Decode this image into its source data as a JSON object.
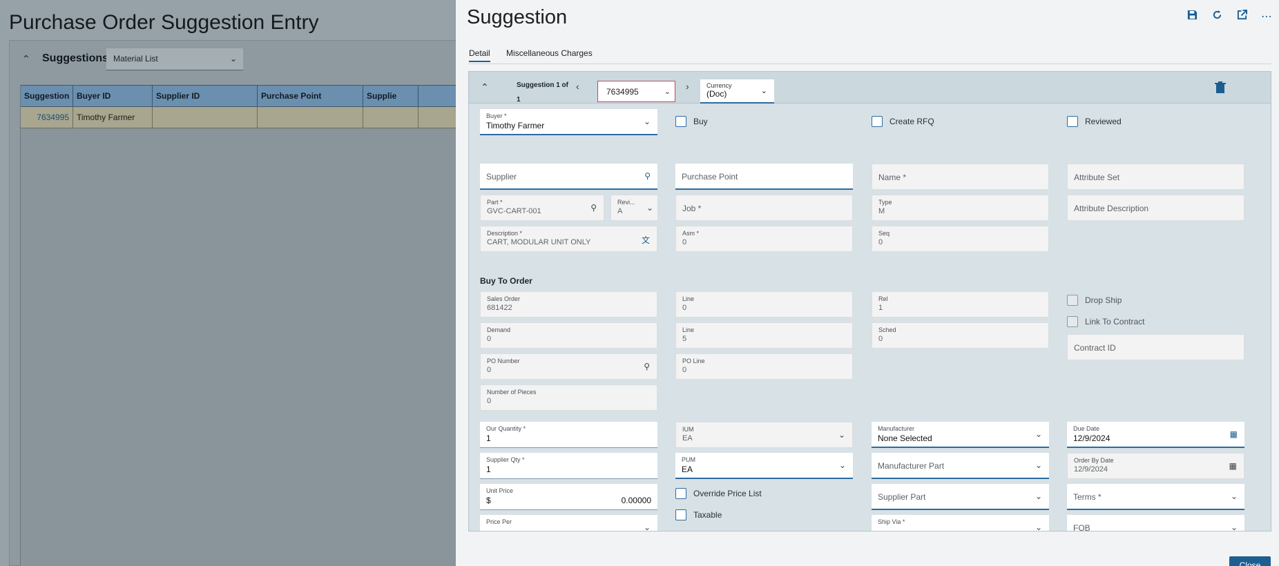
{
  "background": {
    "page_title": "Purchase Order Suggestion Entry",
    "suggestions_title": "Suggestions",
    "list_select": "Material List",
    "grid_headers": [
      "Suggestion",
      "Buyer ID",
      "Supplier ID",
      "Purchase Point",
      "Supplie"
    ],
    "grid_row": [
      "7634995",
      "Timothy Farmer",
      "",
      "",
      ""
    ]
  },
  "drawer": {
    "title": "Suggestion",
    "toolbar": {
      "save": "save-icon",
      "refresh": "refresh-icon",
      "popout": "external-link-icon",
      "more": "more-icon"
    },
    "tabs": [
      "Detail",
      "Miscellaneous Charges"
    ],
    "nav": {
      "text_line1": "Suggestion 1 of",
      "text_line2": "1",
      "value": "7634995"
    },
    "currency": {
      "label": "Currency",
      "value": "(Doc)"
    },
    "buyer": {
      "label": "Buyer *",
      "value": "Timothy Farmer"
    },
    "checks": {
      "buy": "Buy",
      "create_rfq": "Create RFQ",
      "reviewed": "Reviewed",
      "drop_ship": "Drop Ship",
      "link_contract": "Link To Contract",
      "override": "Override Price List",
      "taxable": "Taxable"
    },
    "supplier": "Supplier",
    "purchase_point": "Purchase Point",
    "name": "Name *",
    "attribute_set": "Attribute Set",
    "part": {
      "label": "Part *",
      "value": "GVC-CART-001"
    },
    "revision": {
      "label": "Revi...",
      "value": "A"
    },
    "job": "Job *",
    "type": {
      "label": "Type",
      "value": "M"
    },
    "attribute_description": "Attribute Description",
    "description": {
      "label": "Description *",
      "value": "CART, MODULAR UNIT ONLY"
    },
    "asm": {
      "label": "Asm *",
      "value": "0"
    },
    "seq": {
      "label": "Seq",
      "value": "0"
    },
    "buy_to_order": "Buy To Order",
    "sales_order": {
      "label": "Sales Order",
      "value": "681422"
    },
    "line1": {
      "label": "Line",
      "value": "0"
    },
    "rel": {
      "label": "Rel",
      "value": "1"
    },
    "demand": {
      "label": "Demand",
      "value": "0"
    },
    "line2": {
      "label": "Line",
      "value": "5"
    },
    "sched": {
      "label": "Sched",
      "value": "0"
    },
    "contract_id": "Contract ID",
    "po_number": {
      "label": "PO Number",
      "value": "0"
    },
    "po_line": {
      "label": "PO Line",
      "value": "0"
    },
    "pieces": {
      "label": "Number of Pieces",
      "value": "0"
    },
    "our_qty": {
      "label": "Our Quantity *",
      "value": "1"
    },
    "ium": {
      "label": "IUM",
      "value": "EA"
    },
    "manufacturer": {
      "label": "Manufacturer",
      "value": "None Selected"
    },
    "due_date": {
      "label": "Due Date",
      "value": "12/9/2024"
    },
    "supplier_qty": {
      "label": "Supplier Qty *",
      "value": "1"
    },
    "pum": {
      "label": "PUM",
      "value": "EA"
    },
    "manufacturer_part": "Manufacturer Part",
    "order_by_date": {
      "label": "Order By Date",
      "value": "12/9/2024"
    },
    "unit_price": {
      "label": "Unit Price",
      "currency": "$",
      "value": "0.00000"
    },
    "supplier_part": "Supplier Part",
    "terms": "Terms *",
    "price_per": {
      "label": "Price Per"
    },
    "ship_via": {
      "label": "Ship Via *"
    },
    "fob": "FOB",
    "close": "Close"
  }
}
